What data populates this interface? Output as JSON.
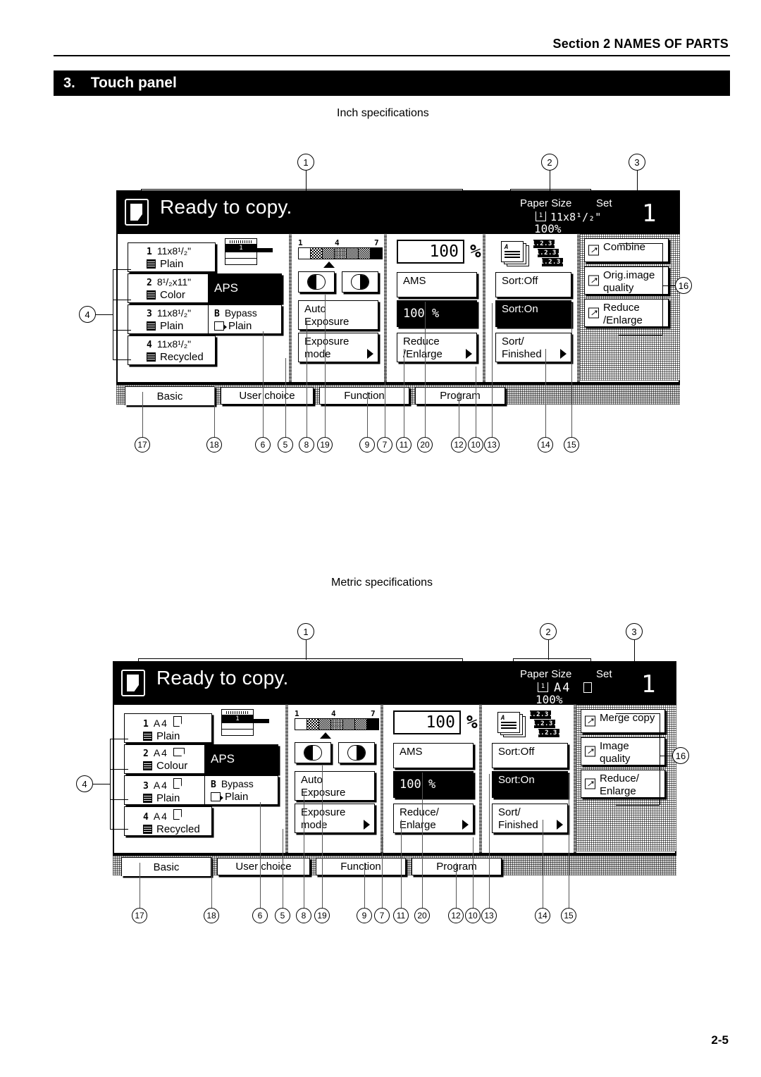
{
  "header": {
    "section": "Section 2  NAMES OF PARTS",
    "title_number": "3.",
    "title": "Touch panel",
    "page_number": "2-5"
  },
  "inch_label": "Inch specifications",
  "metric_label": "Metric specifications",
  "inch_panel": {
    "status_message": "Ready to copy.",
    "paper_size_label": "Paper Size",
    "set_label": "Set",
    "paper_size_value": "11x8¹/₂\"",
    "zoom_status": "100%",
    "copy_count": "1",
    "cassettes": [
      {
        "no": "1",
        "size": "11x8¹/₂\"",
        "media": "Plain",
        "orientation": "portrait"
      },
      {
        "no": "2",
        "size": "8¹/₂x11\"",
        "media": "Color",
        "orientation": "landscape"
      },
      {
        "no": "3",
        "size": "11x8¹/₂\"",
        "media": "Plain",
        "orientation": "portrait"
      },
      {
        "no": "4",
        "size": "11x8¹/₂\"",
        "media": "Recycled",
        "orientation": "portrait"
      }
    ],
    "aps_label": "APS",
    "bypass_letter": "B",
    "bypass_label": "Bypass",
    "bypass_media": "Plain",
    "scanner_cassette_number": "1",
    "exposure_scale": {
      "min": "1",
      "mid": "4",
      "max": "7"
    },
    "auto_exposure_l1": "Auto",
    "auto_exposure_l2": "Exposure",
    "exposure_mode_l1": "Exposure",
    "exposure_mode_l2": "mode",
    "zoom_value": "100",
    "percent_symbol": "%",
    "ams_label": "AMS",
    "zoom_preset": "100 %",
    "reduce_enlarge_l1": "Reduce",
    "reduce_enlarge_l2": "/Enlarge",
    "sort_off": "Sort:Off",
    "sort_on": "Sort:On",
    "sort_finished_l1": "Sort/",
    "sort_finished_l2": "Finished",
    "sort_num_1": "1.2.3.",
    "sort_num_2": "1.2.3.",
    "sort_num_3": "1.2.3.",
    "right_keys": [
      {
        "l1": "Combine",
        "l2": ""
      },
      {
        "l1": "Orig.image",
        "l2": "quality"
      },
      {
        "l1": "Reduce",
        "l2": "/Enlarge"
      }
    ],
    "tabs": [
      {
        "label": "Basic",
        "active": true
      },
      {
        "label": "User choice",
        "active": false
      },
      {
        "label": "Function",
        "active": false
      },
      {
        "label": "Program",
        "active": false
      }
    ]
  },
  "metric_panel": {
    "status_message": "Ready to copy.",
    "paper_size_label": "Paper Size",
    "set_label": "Set",
    "paper_size_value": "A4",
    "zoom_status": "100%",
    "copy_count": "1",
    "cassettes": [
      {
        "no": "1",
        "size": "A4",
        "media": "Plain",
        "orientation": "portrait"
      },
      {
        "no": "2",
        "size": "A4",
        "media": "Colour",
        "orientation": "landscape"
      },
      {
        "no": "3",
        "size": "A4",
        "media": "Plain",
        "orientation": "portrait"
      },
      {
        "no": "4",
        "size": "A4",
        "media": "Recycled",
        "orientation": "portrait"
      }
    ],
    "aps_label": "APS",
    "bypass_letter": "B",
    "bypass_label": "Bypass",
    "bypass_media": "Plain",
    "scanner_cassette_number": "1",
    "exposure_scale": {
      "min": "1",
      "mid": "4",
      "max": "7"
    },
    "auto_exposure_l1": "Auto",
    "auto_exposure_l2": "Exposure",
    "exposure_mode_l1": "Exposure",
    "exposure_mode_l2": "mode",
    "zoom_value": "100",
    "percent_symbol": "%",
    "ams_label": "AMS",
    "zoom_preset": "100 %",
    "reduce_enlarge_l1": "Reduce/",
    "reduce_enlarge_l2": "Enlarge",
    "sort_off": "Sort:Off",
    "sort_on": "Sort:On",
    "sort_finished_l1": "Sort/",
    "sort_finished_l2": "Finished",
    "sort_num_1": "1.2.3.",
    "sort_num_2": "1.2.3.",
    "sort_num_3": "1.2.3.",
    "right_keys": [
      {
        "l1": "Merge copy",
        "l2": ""
      },
      {
        "l1": "Image",
        "l2": "quality"
      },
      {
        "l1": "Reduce/",
        "l2": "Enlarge"
      }
    ],
    "tabs": [
      {
        "label": "Basic",
        "active": true
      },
      {
        "label": "User choice",
        "active": false
      },
      {
        "label": "Function",
        "active": false
      },
      {
        "label": "Program",
        "active": false
      }
    ]
  },
  "callouts": {
    "top": [
      "1",
      "2",
      "3"
    ],
    "left": "4",
    "right": "16",
    "bottom": [
      "17",
      "18",
      "6",
      "5",
      "8",
      "19",
      "9",
      "7",
      "11",
      "20",
      "12",
      "10",
      "13",
      "14",
      "15"
    ]
  }
}
